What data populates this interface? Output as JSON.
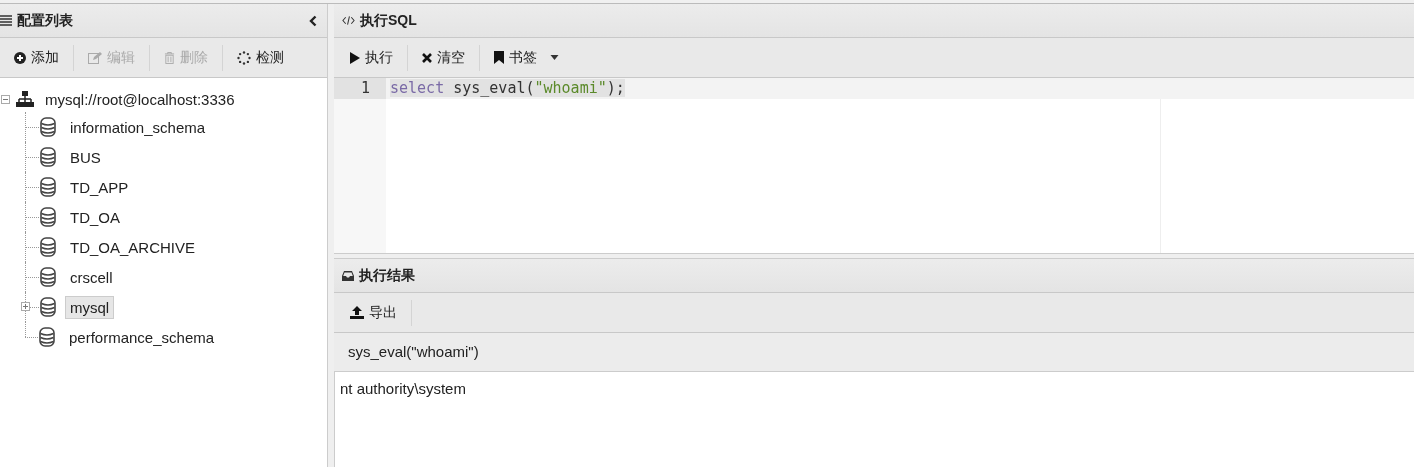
{
  "sidebar": {
    "title": "配置列表",
    "toolbar": [
      {
        "kind": "add",
        "label": "添加",
        "disabled": false
      },
      {
        "kind": "edit",
        "label": "编辑",
        "disabled": true
      },
      {
        "kind": "delete",
        "label": "删除",
        "disabled": true
      },
      {
        "kind": "check",
        "label": "检测",
        "disabled": false
      }
    ],
    "tree": {
      "label": "mysql://root@localhost:3336",
      "expanded": true,
      "children": [
        {
          "label": "information_schema",
          "selected": false,
          "expandable": false
        },
        {
          "label": "BUS",
          "selected": false,
          "expandable": false
        },
        {
          "label": "TD_APP",
          "selected": false,
          "expandable": false
        },
        {
          "label": "TD_OA",
          "selected": false,
          "expandable": false
        },
        {
          "label": "TD_OA_ARCHIVE",
          "selected": false,
          "expandable": false
        },
        {
          "label": "crscell",
          "selected": false,
          "expandable": false
        },
        {
          "label": "mysql",
          "selected": true,
          "expandable": true
        },
        {
          "label": "performance_schema",
          "selected": false,
          "expandable": false
        }
      ]
    }
  },
  "editor": {
    "title": "执行SQL",
    "toolbar": [
      {
        "kind": "run",
        "label": "执行",
        "dropdown": false
      },
      {
        "kind": "clear",
        "label": "清空",
        "dropdown": false
      },
      {
        "kind": "bookmark",
        "label": "书签",
        "dropdown": true
      }
    ],
    "lines": [
      {
        "number": "1",
        "active": true,
        "tokens": [
          {
            "kind": "keyword",
            "text": "select"
          },
          {
            "kind": "plain",
            "text": " sys_eval("
          },
          {
            "kind": "string",
            "text": "\"whoami\""
          },
          {
            "kind": "plain",
            "text": ");"
          }
        ]
      }
    ]
  },
  "results": {
    "title": "执行结果",
    "toolbar": [
      {
        "kind": "export",
        "label": "导出"
      }
    ],
    "columns": [
      "sys_eval(\"whoami\")"
    ],
    "rows": [
      [
        "nt authority\\system"
      ]
    ]
  }
}
